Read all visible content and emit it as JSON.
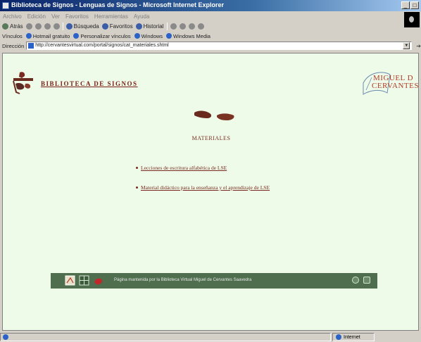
{
  "window": {
    "title": "Biblioteca de Signos - Lenguas de Signos - Microsoft Internet Explorer"
  },
  "menubar": [
    "Archivo",
    "Edición",
    "Ver",
    "Favoritos",
    "Herramientas",
    "Ayuda"
  ],
  "toolbar": {
    "back": "Atrás",
    "search": "Búsqueda",
    "favorites": "Favoritos",
    "history": "Historial"
  },
  "linksbar": {
    "label": "Vínculos",
    "items": [
      "Hotmail gratuito",
      "Personalizar vínculos",
      "Windows",
      "Windows Media"
    ]
  },
  "address": {
    "label": "Dirección",
    "url": "http://cervantesvirtual.com/portal/signos/cat_materiales.shtml"
  },
  "page": {
    "site_title": "BIBLIOTECA DE SIGNOS",
    "logo_right_line1": "MIGUEL D",
    "logo_right_line2": "CERVANTES",
    "section_heading": "MATERIALES",
    "links": [
      "Lecciones de escritura alfabética de LSE",
      "Material didáctico para la enseñanza y el aprendizaje de LSE"
    ],
    "footer_text": "Página mantenida por la Biblioteca Virtual Miguel de Cervantes Saavedra"
  },
  "statusbar": {
    "zone": "Internet"
  }
}
